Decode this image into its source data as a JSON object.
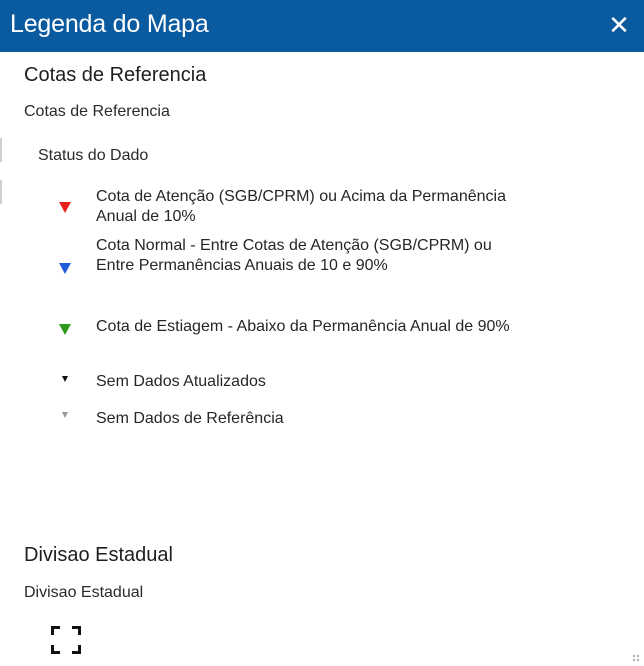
{
  "window": {
    "title": "Legenda do Mapa",
    "close_glyph": "✕",
    "accent_color": "#0a5a9f"
  },
  "sections": [
    {
      "title": "Cotas de Referencia",
      "layer_name": "Cotas de Referencia",
      "field_name": "Status do Dado",
      "items": [
        {
          "label": "Cota de Atenção (SGB/CPRM) ou Acima da Permanência Anual de 10%",
          "symbol": "triangle-down-red-icon",
          "color": "#e8201a"
        },
        {
          "label": "Cota Normal - Entre Cotas de Atenção (SGB/CPRM) ou Entre Permanências Anuais de 10 e 90%",
          "symbol": "triangle-down-blue-icon",
          "color": "#1f5bd6"
        },
        {
          "label": "Cota de Estiagem - Abaixo da Permanência Anual de 90%",
          "symbol": "triangle-down-green-icon",
          "color": "#2e9a1b"
        },
        {
          "label": "Sem Dados Atualizados",
          "symbol": "triangle-down-black-icon",
          "color": "#111111"
        },
        {
          "label": "Sem Dados de Referência",
          "symbol": "triangle-down-gray-icon",
          "color": "#9a9a9a"
        }
      ]
    },
    {
      "title": "Divisao Estadual",
      "layer_name": "Divisao Estadual",
      "items": [
        {
          "label": "",
          "symbol": "dashed-outline-polygon-icon",
          "color": "#111111"
        }
      ]
    }
  ]
}
